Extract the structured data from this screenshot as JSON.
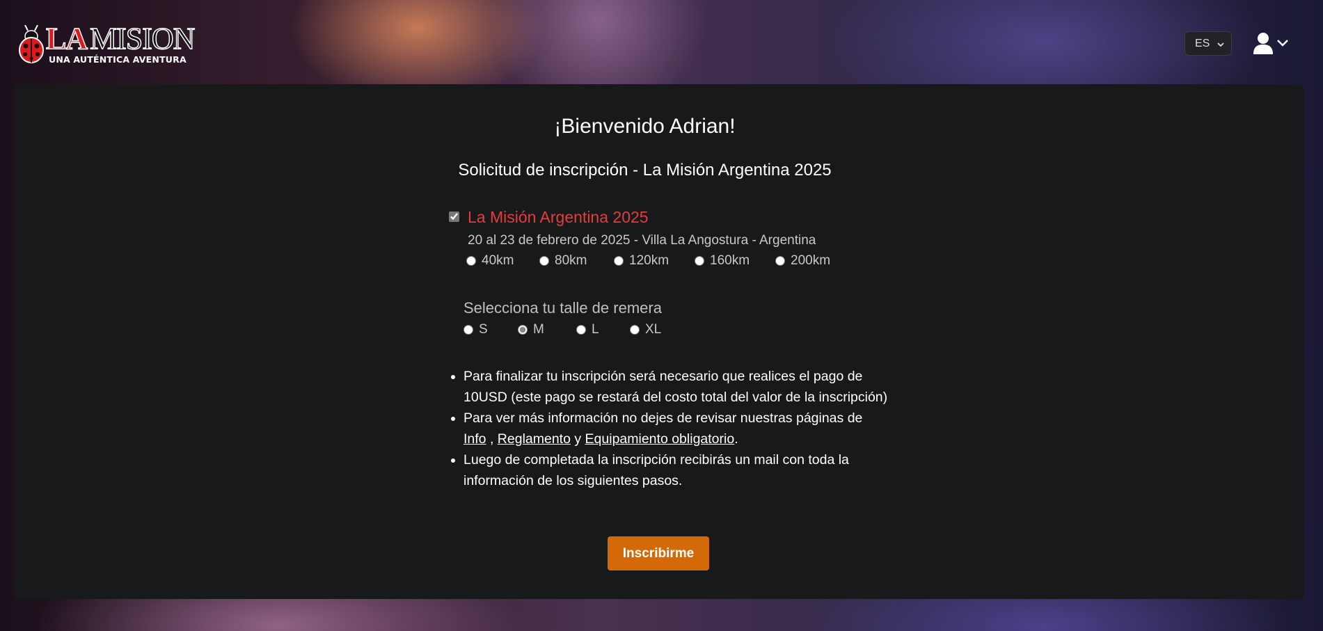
{
  "brand": {
    "logo_main_red": "LA",
    "logo_main": "MISION",
    "tagline": "UNA AUTÉNTICA AVENTURA",
    "accent_color": "#e0191d"
  },
  "header": {
    "language": {
      "selected": "ES",
      "icon": "chevron-down-icon"
    },
    "user_menu": {
      "icon": "user-icon",
      "chevron_icon": "chevron-down-icon"
    }
  },
  "main": {
    "welcome": "¡Bienvenido Adrian!",
    "subtitle": "Solicitud de inscripción - La Misión Argentina 2025",
    "event": {
      "checked": true,
      "title": "La Misión Argentina 2025",
      "title_color": "#e63c3c",
      "details": "20 al 23 de febrero de 2025 - Villa La Angostura - Argentina",
      "distances": [
        "40km",
        "80km",
        "120km",
        "160km",
        "200km"
      ],
      "selected_distance": null
    },
    "shirt": {
      "label": "Selecciona tu talle de remera",
      "sizes": [
        "S",
        "M",
        "L",
        "XL"
      ],
      "selected_size": "M"
    },
    "info": {
      "item1": "Para finalizar tu inscripción será necesario que realices el pago de 10USD (este pago se restará del costo total del valor de la inscripción)",
      "item2_prefix": "Para ver más información no dejes de revisar nuestras páginas de",
      "item2_link_info": "Info",
      "item2_sep1": ",",
      "item2_link_reglamento": "Reglamento",
      "item2_sep2": "y",
      "item2_link_equipamiento": "Equipamiento obligatorio",
      "item2_suffix": ".",
      "item3": "Luego de completada la inscripción recibirás un mail con toda la información de los siguientes pasos."
    },
    "submit_label": "Inscribirme",
    "submit_color": "#d4690a"
  }
}
